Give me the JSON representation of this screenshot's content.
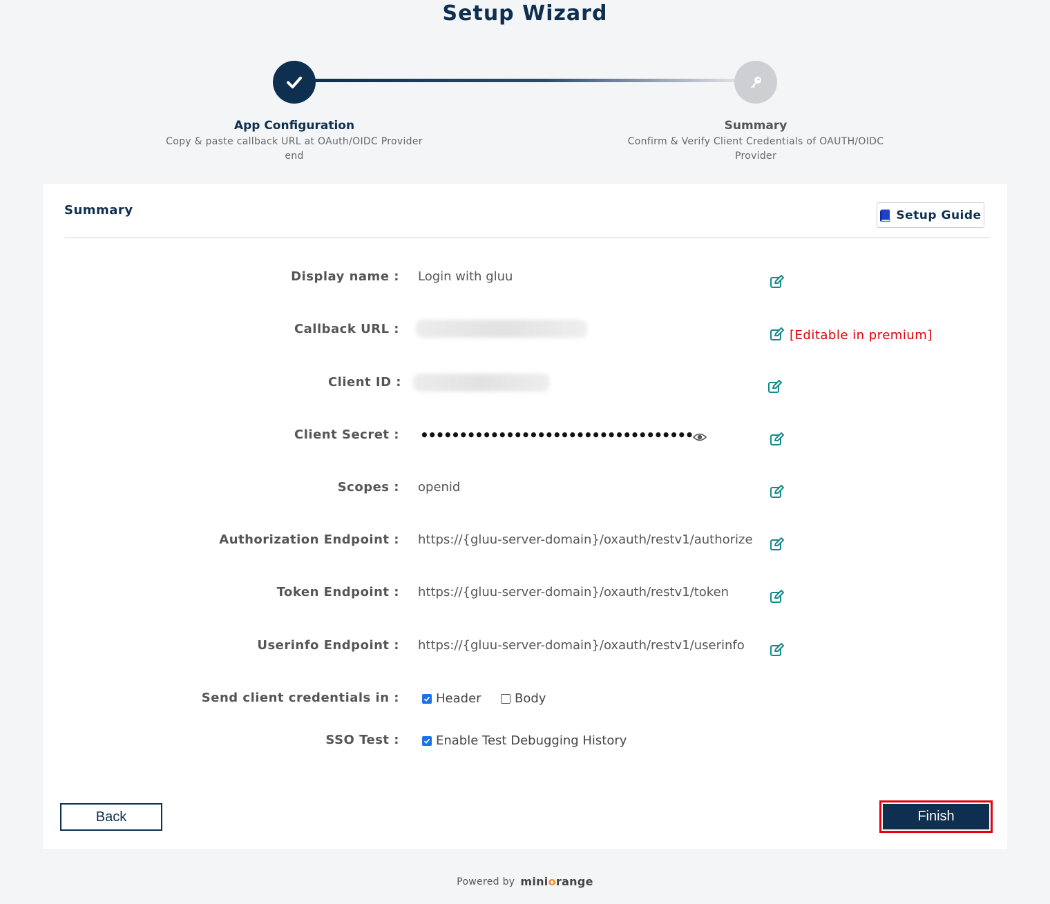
{
  "header": {
    "title": "Setup Wizard"
  },
  "steps": [
    {
      "label": "App Configuration",
      "description": "Copy & paste callback URL at OAuth/OIDC Provider end",
      "icon": "check-icon",
      "color": "#0e2f4f"
    },
    {
      "label": "Summary",
      "description": "Confirm & Verify Client Credentials of OAUTH/OIDC Provider",
      "icon": "key-icon",
      "color": "#555555"
    }
  ],
  "card": {
    "title": "Summary",
    "setup_guide_label": "Setup Guide",
    "setup_guide_icon": "book-icon"
  },
  "fields": {
    "display_name": {
      "label": "Display name :",
      "value": "Login with gluu"
    },
    "callback_url": {
      "label": "Callback URL :",
      "value": "",
      "note": "[Editable in premium]"
    },
    "client_id": {
      "label": "Client ID :",
      "value": ""
    },
    "client_secret": {
      "label": "Client Secret :",
      "value": "•••••••••••••••••••••••••••••••••••"
    },
    "scopes": {
      "label": "Scopes :",
      "value": "openid"
    },
    "authorization_endpoint": {
      "label": "Authorization Endpoint :",
      "value": "https://{gluu-server-domain}/oxauth/restv1/authorize"
    },
    "token_endpoint": {
      "label": "Token Endpoint :",
      "value": "https://{gluu-server-domain}/oxauth/restv1/token"
    },
    "userinfo_endpoint": {
      "label": "Userinfo Endpoint :",
      "value": "https://{gluu-server-domain}/oxauth/restv1/userinfo"
    },
    "send_credentials": {
      "label": "Send client credentials in :",
      "header_label": "Header",
      "header_checked": true,
      "body_label": "Body",
      "body_checked": false
    },
    "sso_test": {
      "label": "SSO Test :",
      "option_label": "Enable Test Debugging History",
      "checked": true
    }
  },
  "buttons": {
    "back": "Back",
    "finish": "Finish"
  },
  "footer": {
    "powered_by": "Powered by",
    "brand_pre": "mini",
    "brand_o": "o",
    "brand_post": "range"
  },
  "colors": {
    "primary": "#0e2f4f",
    "edit_icon": "#138a8a",
    "premium_note": "#e00000",
    "highlight": "#e5000e"
  }
}
